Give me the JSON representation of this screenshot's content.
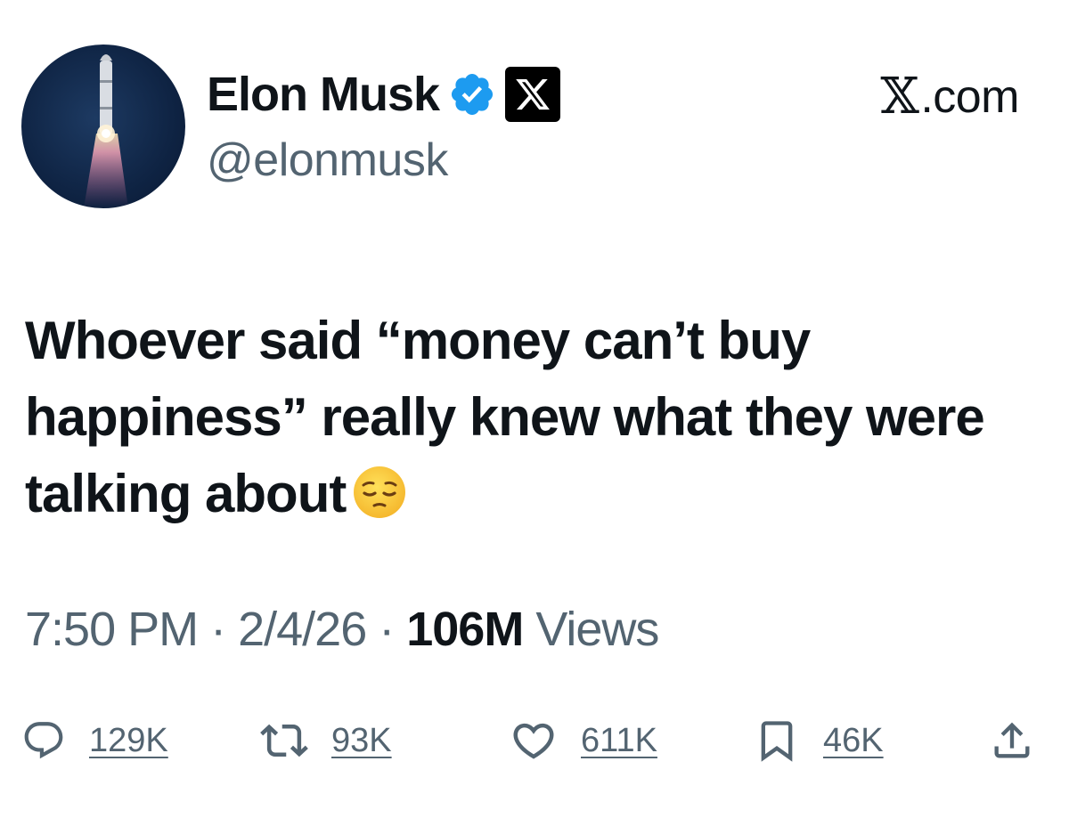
{
  "author": {
    "display_name": "Elon Musk",
    "handle": "@elonmusk",
    "verified": true,
    "affiliation_icon": "x-logo-icon"
  },
  "site": {
    "label": ".com",
    "logo": "𝕏"
  },
  "tweet": {
    "text": "Whoever said “money can’t buy happiness” really knew what they were talking about",
    "emoji": "pensive-face-icon",
    "time": "7:50 PM",
    "separator": "·",
    "date": "2/4/26",
    "views_count": "106M",
    "views_label": "Views"
  },
  "actions": {
    "replies": "129K",
    "reposts": "93K",
    "likes": "611K",
    "bookmarks": "46K"
  },
  "colors": {
    "text_primary": "#0f1419",
    "text_secondary": "#536471",
    "verified_blue": "#1d9bf0",
    "background": "#ffffff"
  }
}
